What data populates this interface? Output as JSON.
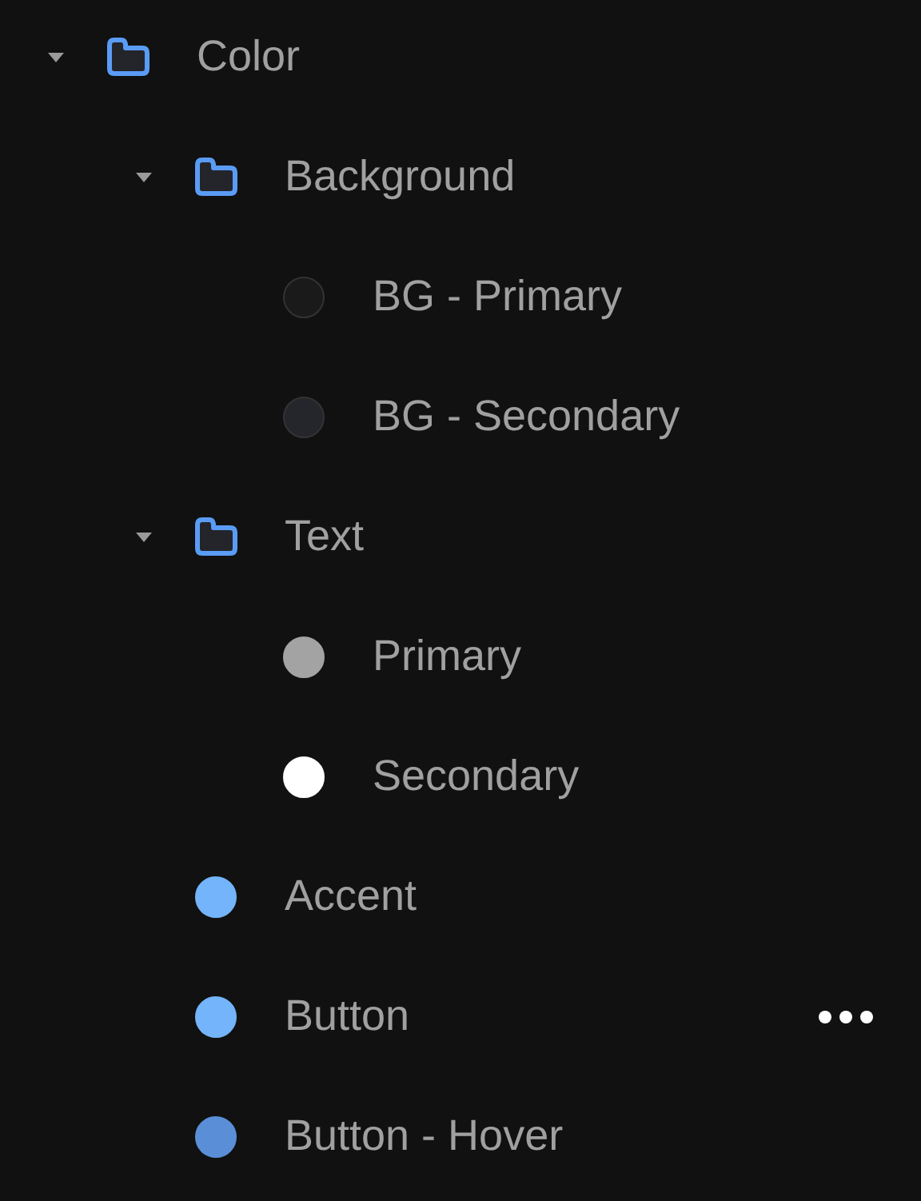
{
  "tree": [
    {
      "kind": "folder",
      "label": "Color",
      "expanded": true,
      "hovered": false,
      "children": [
        {
          "kind": "folder",
          "label": "Background",
          "expanded": true,
          "hovered": false,
          "children": [
            {
              "kind": "color",
              "label": "BG - Primary",
              "color": "#1a1a1a",
              "hovered": false
            },
            {
              "kind": "color",
              "label": "BG - Secondary",
              "color": "#24262b",
              "hovered": false
            }
          ]
        },
        {
          "kind": "folder",
          "label": "Text",
          "expanded": true,
          "hovered": false,
          "children": [
            {
              "kind": "color",
              "label": "Primary",
              "color": "#a3a3a3",
              "hovered": false
            },
            {
              "kind": "color",
              "label": "Secondary",
              "color": "#ffffff",
              "hovered": false
            }
          ]
        },
        {
          "kind": "color",
          "label": "Accent",
          "color": "#74b4fb",
          "hovered": false
        },
        {
          "kind": "color",
          "label": "Button",
          "color": "#74b4fb",
          "hovered": true
        },
        {
          "kind": "color",
          "label": "Button - Hover",
          "color": "#5a8fd8",
          "hovered": false
        }
      ]
    }
  ]
}
